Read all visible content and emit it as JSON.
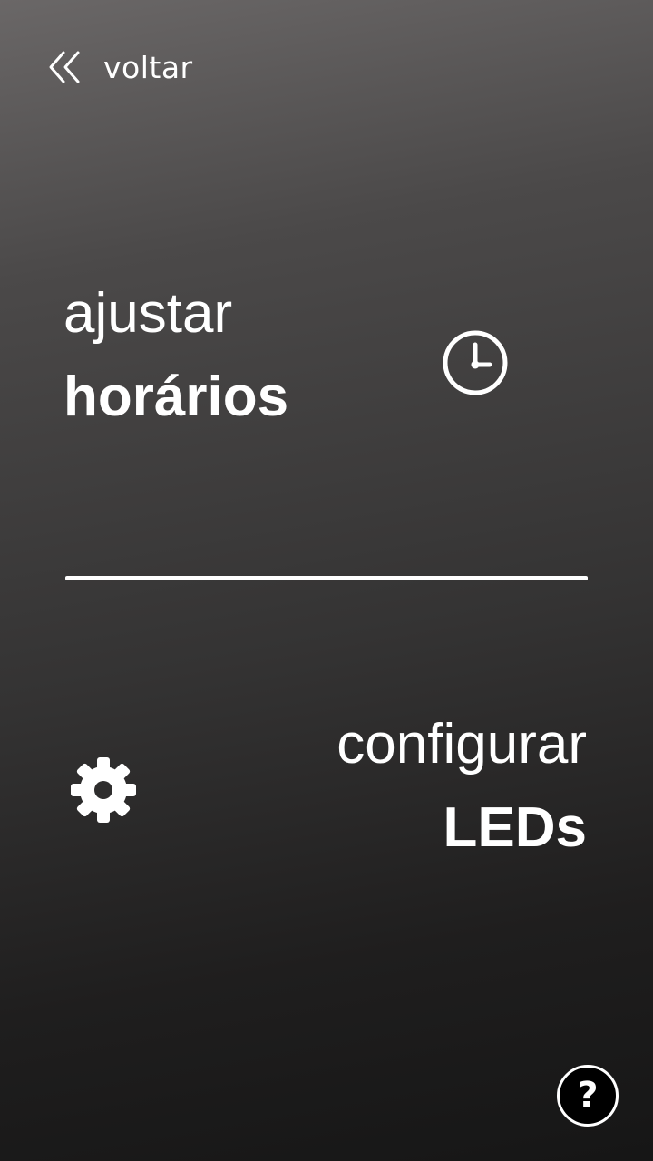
{
  "back": {
    "icon": "double-chevron-left-icon",
    "label": "voltar"
  },
  "menu": {
    "hours": {
      "line1": "ajustar",
      "line2": "horários",
      "icon": "clock-icon"
    },
    "leds": {
      "line1": "configurar",
      "line2": "LEDs",
      "icon": "gear-icon"
    }
  },
  "help": {
    "icon": "question-mark-icon",
    "glyph": "?"
  },
  "colors": {
    "background_top": "#6a6767",
    "background_bottom": "#161616",
    "foreground": "#ffffff",
    "help_background": "#000000"
  }
}
